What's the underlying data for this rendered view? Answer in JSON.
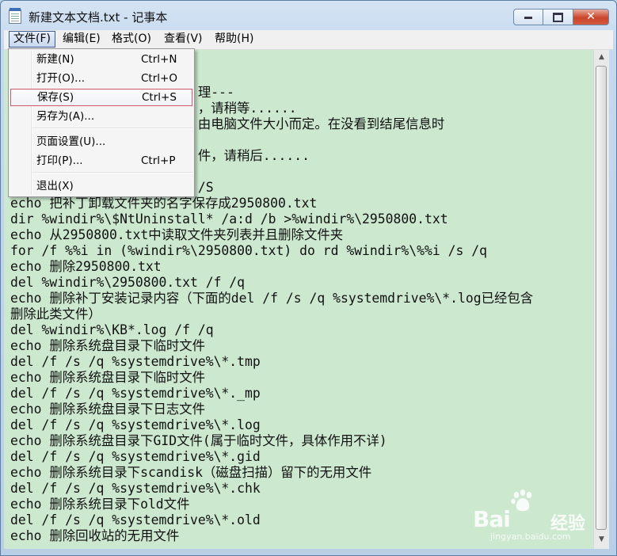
{
  "window": {
    "title": "新建文本文档.txt - 记事本",
    "controls": {
      "minimize": "",
      "maximize": "",
      "close": "✕"
    }
  },
  "menubar": {
    "items": [
      {
        "label": "文件(F)"
      },
      {
        "label": "编辑(E)"
      },
      {
        "label": "格式(O)"
      },
      {
        "label": "查看(V)"
      },
      {
        "label": "帮助(H)"
      }
    ]
  },
  "file_menu": {
    "items": [
      {
        "label": "新建(N)",
        "shortcut": "Ctrl+N"
      },
      {
        "label": "打开(O)...",
        "shortcut": "Ctrl+O"
      },
      {
        "label": "保存(S)",
        "shortcut": "Ctrl+S"
      },
      {
        "label": "另存为(A)...",
        "shortcut": ""
      },
      {
        "label": "页面设置(U)...",
        "shortcut": ""
      },
      {
        "label": "打印(P)...",
        "shortcut": "Ctrl+P"
      },
      {
        "label": "退出(X)",
        "shortcut": ""
      }
    ],
    "highlighted": "保存(S)"
  },
  "editor": {
    "lines": [
      "",
      "",
      "                        理---",
      "                        ，请稍等......",
      "                        由电脑文件大小而定。在没看到结尾信息时",
      "",
      "                        件，请稍后......",
      "",
      "                        /S",
      "echo 把补丁卸载文件夹的名字保存成2950800.txt",
      "dir %windir%\\$NtUninstall* /a:d /b >%windir%\\2950800.txt",
      "echo 从2950800.txt中读取文件夹列表并且删除文件夹",
      "for /f %%i in (%windir%\\2950800.txt) do rd %windir%\\%%i /s /q",
      "echo 删除2950800.txt",
      "del %windir%\\2950800.txt /f /q",
      "echo 删除补丁安装记录内容（下面的del /f /s /q %systemdrive%\\*.log已经包含",
      "删除此类文件）",
      "del %windir%\\KB*.log /f /q",
      "echo 删除系统盘目录下临时文件",
      "del /f /s /q %systemdrive%\\*.tmp",
      "echo 删除系统盘目录下临时文件",
      "del /f /s /q %systemdrive%\\*._mp",
      "echo 删除系统盘目录下日志文件",
      "del /f /s /q %systemdrive%\\*.log",
      "echo 删除系统盘目录下GID文件(属于临时文件，具体作用不详)",
      "del /f /s /q %systemdrive%\\*.gid",
      "echo 删除系统目录下scandisk（磁盘扫描）留下的无用文件",
      "del /f /s /q %systemdrive%\\*.chk",
      "echo 删除系统目录下old文件",
      "del /f /s /q %systemdrive%\\*.old",
      "echo 删除回收站的无用文件"
    ]
  },
  "watermark": {
    "brand": "Bai",
    "brand_suffix": "经验",
    "url": "jingyan.baidu.com"
  },
  "colors": {
    "editor_bg": "#cce8cf",
    "highlight_border": "#d15a6a"
  }
}
